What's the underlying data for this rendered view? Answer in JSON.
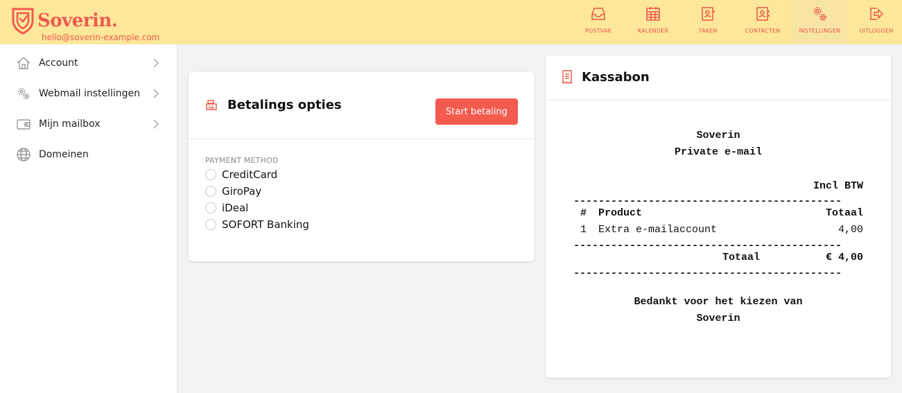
{
  "header": {
    "logo_text": "Soverin.",
    "email": "hello@soverin-example.com",
    "nav": [
      {
        "label": "POSTVAK",
        "icon": "inbox-icon"
      },
      {
        "label": "KALENDER",
        "icon": "calendar-icon"
      },
      {
        "label": "TAKEN",
        "icon": "tasks-icon"
      },
      {
        "label": "CONTACTEN",
        "icon": "contacts-icon"
      },
      {
        "label": "INSTELLINGEN",
        "icon": "settings-gears-icon",
        "active": true
      },
      {
        "label": "UITLOGGEN",
        "icon": "logout-icon"
      }
    ],
    "accent_color": "#f05a4f",
    "background_color": "#fde79a"
  },
  "sidebar": {
    "items": [
      {
        "label": "Account",
        "icon": "home-icon",
        "has_chevron": true
      },
      {
        "label": "Webmail instellingen",
        "icon": "gears-icon",
        "has_chevron": true
      },
      {
        "label": "Mijn mailbox",
        "icon": "wallet-icon",
        "has_chevron": true
      },
      {
        "label": "Domeinen",
        "icon": "globe-icon",
        "has_chevron": false
      }
    ]
  },
  "payment": {
    "title": "Betalings opties",
    "start_button": "Start betaling",
    "method_label": "PAYMENT METHOD",
    "methods": [
      "CreditCard",
      "GiroPay",
      "iDeal",
      "SOFORT Banking"
    ],
    "button_color": "#f45b4f"
  },
  "receipt": {
    "title": "Kassabon",
    "company": "Soverin",
    "product_name": "Private e-mail",
    "tax_note": "Incl BTW",
    "separator": "-------------------------------------------",
    "columns": {
      "num": "#",
      "product": "Product",
      "total": "Totaal"
    },
    "rows": [
      {
        "num": "1",
        "product": "Extra e-mailaccount",
        "total": "4,00"
      }
    ],
    "total_label": "Totaal",
    "total_value": "€ 4,00",
    "thanks_line1": "Bedankt voor het kiezen van",
    "thanks_line2": "Soverin"
  }
}
